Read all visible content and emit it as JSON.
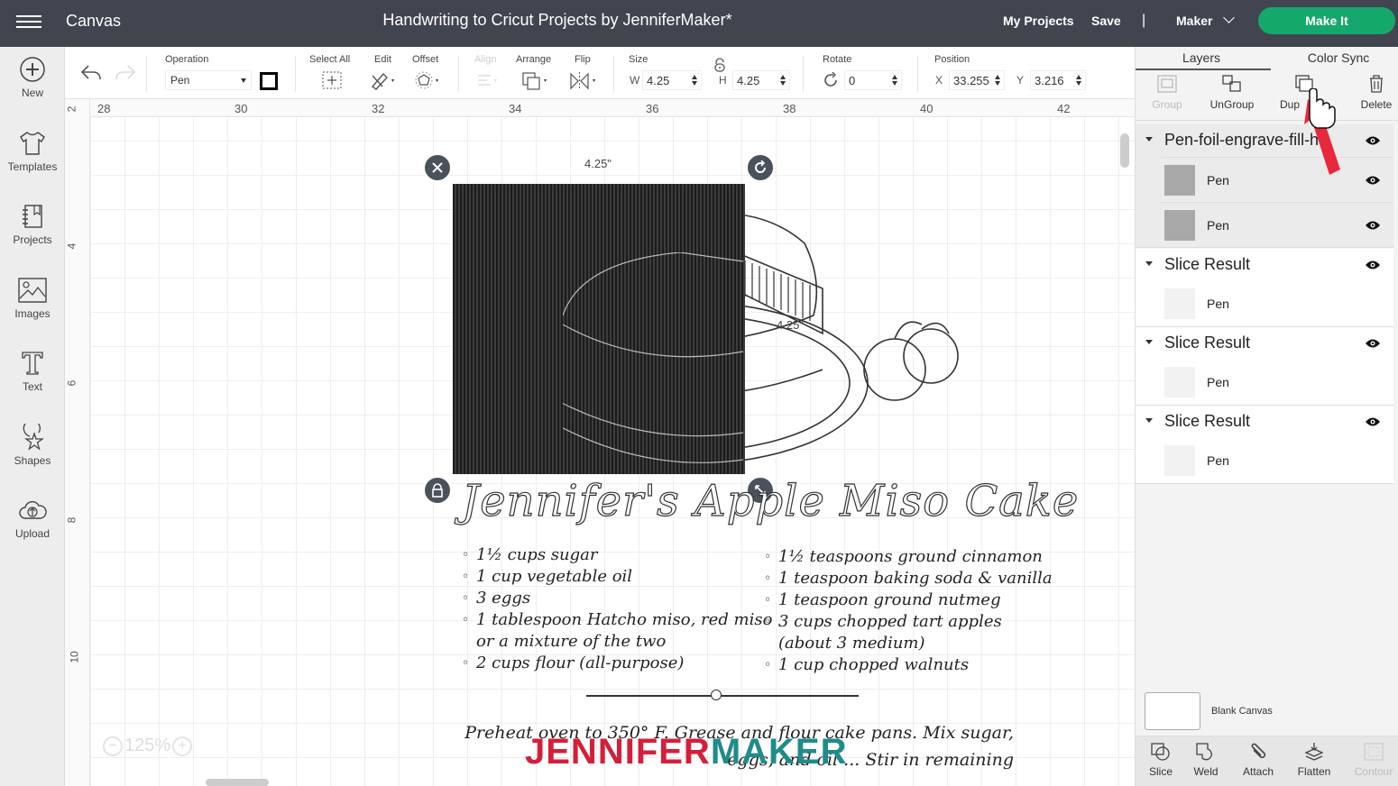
{
  "header": {
    "app_title": "Canvas",
    "document_title": "Handwriting to Cricut Projects by JenniferMaker*",
    "my_projects": "My Projects",
    "save": "Save",
    "divider": "|",
    "machine": "Maker",
    "make_it": "Make It"
  },
  "toolbar": {
    "operation_label": "Operation",
    "operation_value": "Pen",
    "select_all_label": "Select All",
    "edit_label": "Edit",
    "offset_label": "Offset",
    "align_label": "Align",
    "arrange_label": "Arrange",
    "flip_label": "Flip",
    "size_label": "Size",
    "w_prefix": "W",
    "w_value": "4.25",
    "h_prefix": "H",
    "h_value": "4.25",
    "rotate_label": "Rotate",
    "rotate_value": "0",
    "position_label": "Position",
    "x_prefix": "X",
    "x_value": "33.255",
    "y_prefix": "Y",
    "y_value": "3.216"
  },
  "leftnav": {
    "items": [
      {
        "label": "New",
        "icon": "plus-circle-icon"
      },
      {
        "label": "Templates",
        "icon": "tshirt-icon"
      },
      {
        "label": "Projects",
        "icon": "notebook-icon"
      },
      {
        "label": "Images",
        "icon": "image-icon"
      },
      {
        "label": "Text",
        "icon": "text-t-icon"
      },
      {
        "label": "Shapes",
        "icon": "shapes-icon"
      },
      {
        "label": "Upload",
        "icon": "cloud-upload-icon"
      }
    ]
  },
  "canvas": {
    "ruler_top": [
      "28",
      "30",
      "32",
      "34",
      "36",
      "38",
      "40",
      "42"
    ],
    "ruler_left": [
      "2",
      "4",
      "6",
      "8",
      "10"
    ],
    "selection_width_label": "4.25\"",
    "selection_height_label": "4.25\"",
    "zoom_level": "125%",
    "recipe": {
      "title": "Jennifer's Apple Miso Cake",
      "left_ingredients": [
        "1½ cups sugar",
        "1 cup vegetable oil",
        "3 eggs",
        "1 tablespoon Hatcho miso, red miso",
        "or a mixture of the two",
        "2 cups flour (all-purpose)"
      ],
      "right_ingredients": [
        "1½ teaspoons ground cinnamon",
        "1 teaspoon baking soda & vanilla",
        "1 teaspoon ground nutmeg",
        "3 cups chopped tart apples",
        "(about 3 medium)",
        "1 cup chopped walnuts"
      ],
      "instructions_line1": "Preheat oven to 350° F. Grease and flour cake pans. Mix sugar,",
      "instructions_line2": "eggs, and oil ... Stir in remaining"
    },
    "watermark_a": "JENNIFER",
    "watermark_b": "MAKER"
  },
  "rpanel": {
    "tabs": [
      "Layers",
      "Color Sync"
    ],
    "actions": [
      {
        "label": "Group",
        "disabled": true
      },
      {
        "label": "UnGroup",
        "disabled": false
      },
      {
        "label": "Dup",
        "disabled": false
      },
      {
        "label": "Delete",
        "disabled": false
      }
    ],
    "groups": [
      {
        "name": "Pen-foil-engrave-fill-h...",
        "children": [
          "Pen",
          "Pen"
        ]
      },
      {
        "name": "Slice Result",
        "children": [
          "Pen"
        ]
      },
      {
        "name": "Slice Result",
        "children": [
          "Pen"
        ]
      },
      {
        "name": "Slice Result",
        "children": [
          "Pen"
        ]
      }
    ],
    "blank_canvas": "Blank Canvas",
    "bottom_actions": [
      {
        "label": "Slice",
        "disabled": false
      },
      {
        "label": "Weld",
        "disabled": false
      },
      {
        "label": "Attach",
        "disabled": false
      },
      {
        "label": "Flatten",
        "disabled": false
      },
      {
        "label": "Contour",
        "disabled": true
      }
    ]
  },
  "colors": {
    "header_bg": "#414550",
    "make_it_green": "#15a86b",
    "handle_bg": "#4a525b",
    "watermark_red": "#d41f3a",
    "watermark_teal": "#1f8c8a",
    "annotation_arrow": "#e8283c"
  }
}
